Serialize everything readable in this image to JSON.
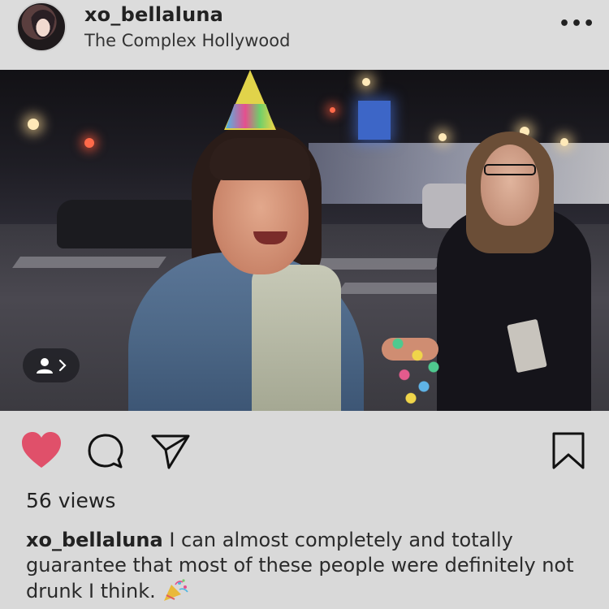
{
  "post": {
    "username": "xo_bellaluna",
    "location": "The Complex Hollywood",
    "more_label": "•••"
  },
  "media": {
    "alt_description": "",
    "tagged_people_button": "person-tag"
  },
  "actions": {
    "liked": true,
    "like_color": "#e0506a"
  },
  "stats": {
    "views": "56 views"
  },
  "caption": {
    "username": "xo_bellaluna",
    "text": "I can almost completely and totally guarantee that most of these people were definitely not drunk I think."
  },
  "icons": {
    "like": "heart-icon",
    "comment": "comment-icon",
    "share": "paper-plane-icon",
    "save": "bookmark-icon",
    "tags": "person-icon",
    "emoji": "party-popper-icon"
  }
}
